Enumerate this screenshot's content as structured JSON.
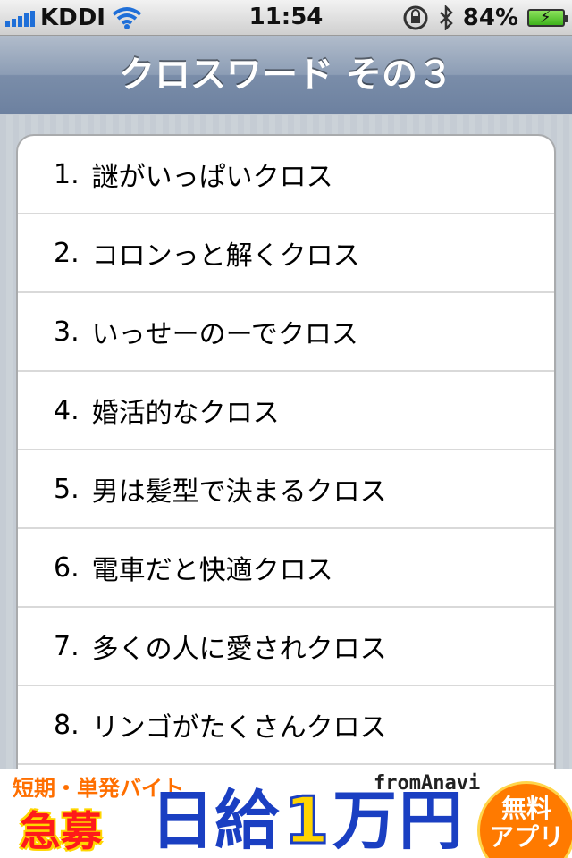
{
  "status_bar": {
    "carrier": "KDDI",
    "time": "11:54",
    "battery": "84%"
  },
  "nav": {
    "title": "クロスワード その３"
  },
  "list": [
    {
      "num": "1.",
      "label": "謎がいっぱいクロス"
    },
    {
      "num": "2.",
      "label": "コロンっと解くクロス"
    },
    {
      "num": "3.",
      "label": "いっせーのーでクロス"
    },
    {
      "num": "4.",
      "label": "婚活的なクロス"
    },
    {
      "num": "5.",
      "label": "男は髪型で決まるクロス"
    },
    {
      "num": "6.",
      "label": "電車だと快適クロス"
    },
    {
      "num": "7.",
      "label": "多くの人に愛されクロス"
    },
    {
      "num": "8.",
      "label": "リンゴがたくさんクロス"
    }
  ],
  "ad": {
    "tagline": "短期・単発バイト",
    "urgent": "急募",
    "brand": "fromAnavi",
    "big_chars": [
      "日",
      "給",
      "1",
      "万",
      "円"
    ],
    "badge_line1": "無料",
    "badge_line2": "アプリ"
  }
}
